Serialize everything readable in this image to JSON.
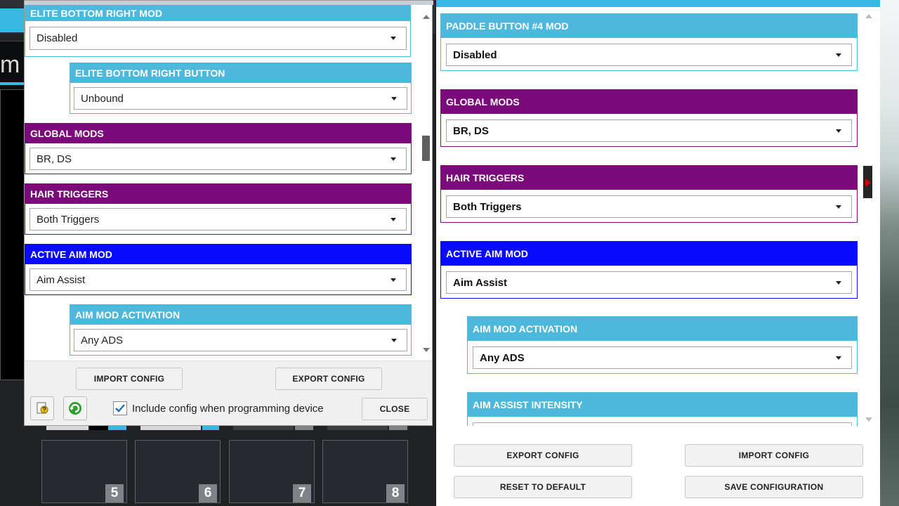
{
  "background_app": {
    "partial_letter": "m",
    "slots": [
      {
        "number": "5"
      },
      {
        "number": "6"
      },
      {
        "number": "7"
      },
      {
        "number": "8"
      }
    ]
  },
  "left_dialog": {
    "sections": {
      "elite_bottom_right_mod": {
        "header": "ELITE BOTTOM RIGHT MOD",
        "value": "Disabled"
      },
      "elite_bottom_right_button": {
        "header": "ELITE BOTTOM RIGHT BUTTON",
        "value": "Unbound"
      },
      "global_mods": {
        "header": "GLOBAL MODS",
        "value": "BR, DS"
      },
      "hair_triggers": {
        "header": "HAIR TRIGGERS",
        "value": "Both Triggers"
      },
      "active_aim_mod": {
        "header": "ACTIVE AIM MOD",
        "value": "Aim Assist"
      },
      "aim_mod_activation": {
        "header": "AIM MOD ACTIVATION",
        "value": "Any ADS"
      }
    },
    "import_label": "IMPORT CONFIG",
    "export_label": "EXPORT CONFIG",
    "include_config_label": "Include config when programming device",
    "include_config_checked": true,
    "close_label": "CLOSE"
  },
  "right_window": {
    "sections": {
      "paddle_button_4_mod": {
        "header": "PADDLE BUTTON #4 MOD",
        "value": "Disabled"
      },
      "global_mods": {
        "header": "GLOBAL MODS",
        "value": "BR, DS"
      },
      "hair_triggers": {
        "header": "HAIR TRIGGERS",
        "value": "Both Triggers"
      },
      "active_aim_mod": {
        "header": "ACTIVE AIM MOD",
        "value": "Aim Assist"
      },
      "aim_mod_activation": {
        "header": "AIM MOD ACTIVATION",
        "value": "Any ADS"
      },
      "aim_assist_intensity": {
        "header": "AIM ASSIST INTENSITY",
        "value": ""
      }
    },
    "export_label": "EXPORT CONFIG",
    "import_label": "IMPORT CONFIG",
    "reset_label": "RESET TO DEFAULT",
    "save_label": "SAVE CONFIGURATION"
  },
  "colors": {
    "light_blue_header": "#4bb8dc",
    "purple_header": "#7b0a7b",
    "blue_header": "#0a0aff",
    "title_bar": "#39b7e4"
  }
}
